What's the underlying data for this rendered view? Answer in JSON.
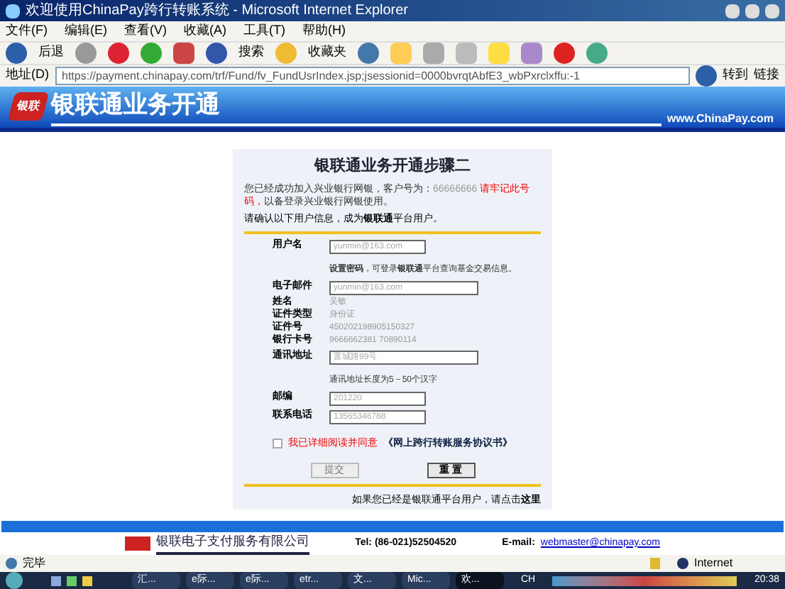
{
  "window": {
    "title": "欢迎使用ChinaPay跨行转账系统 - Microsoft Internet Explorer"
  },
  "menu": [
    "文件(F)",
    "编辑(E)",
    "查看(V)",
    "收藏(A)",
    "工具(T)",
    "帮助(H)"
  ],
  "toolbar": {
    "back": "后退",
    "search": "搜索",
    "favorites": "收藏夹"
  },
  "address": {
    "label": "地址(D)",
    "url": "https://payment.chinapay.com/trf/Fund/fv_FundUsrIndex.jsp;jsessionid=0000bvrqtAbfE3_wbPxrclxffu:-1",
    "go": "转到",
    "links": "链接"
  },
  "banner": {
    "logo_mark": "银联",
    "title": "银联通业务开通",
    "site": "www.ChinaPay.com"
  },
  "panel": {
    "title": "银联通业务开通步骤二",
    "intro": "您已经成功加入兴业银行网银，客户号为：",
    "customer_no": "66666666",
    "warning": "请牢记此号码，",
    "intro2": "以备登录兴业银行网银使用。",
    "prompt": "请确认以下用户信息，成为**银联通**平台用户。",
    "fields": [
      {
        "kind": "input",
        "label": "用户名",
        "value": "yunmin@163.com"
      },
      {
        "kind": "hint",
        "text": "**设置密码**，可登录**银联通**平台查询基金交易信息。"
      },
      {
        "kind": "input",
        "label": "电子邮件",
        "value": "yunmin@163.com",
        "wide": true
      },
      {
        "kind": "text",
        "label": "姓名",
        "value": "吴敏"
      },
      {
        "kind": "text",
        "label": "证件类型",
        "value": "身份证"
      },
      {
        "kind": "text",
        "label": "证件号",
        "value": "450202198905150327"
      },
      {
        "kind": "text",
        "label": "银行卡号",
        "value": "9666662381 70890114"
      },
      {
        "kind": "input",
        "label": "通讯地址",
        "value": "富城路99号",
        "wide": true
      },
      {
        "kind": "hint",
        "text": "通讯地址长度为5－50个汉字"
      },
      {
        "kind": "input",
        "label": "邮编",
        "value": "201220"
      },
      {
        "kind": "input",
        "label": "联系电话",
        "value": "13565346788"
      }
    ],
    "agree": {
      "checked": false,
      "text": "我已详细阅读并同意",
      "link": "《网上跨行转账服务协议书》"
    },
    "buttons": [
      {
        "label": "提交",
        "disabled": true
      },
      {
        "label": "重 置",
        "disabled": false
      }
    ],
    "footer_note": "如果您已经是银联通平台用户，请点击**这里**"
  },
  "footer": {
    "company": "银联电子支付服务有限公司",
    "tel": "Tel: (86-021)52504520",
    "email_label": "E-mail:",
    "email": "webmaster@chinapay.com"
  },
  "status_bar": {
    "text": "完毕",
    "zone": "Internet"
  },
  "taskbar": {
    "tasks": [
      {
        "label": "汇...",
        "selected": false
      },
      {
        "label": "e际...",
        "selected": false
      },
      {
        "label": "e际...",
        "selected": false
      },
      {
        "label": "etr...",
        "selected": false
      },
      {
        "label": "文...",
        "selected": false
      },
      {
        "label": "Mic...",
        "selected": false
      },
      {
        "label": "欢...",
        "selected": true
      }
    ],
    "lang": "CH",
    "clock": "20:38"
  }
}
